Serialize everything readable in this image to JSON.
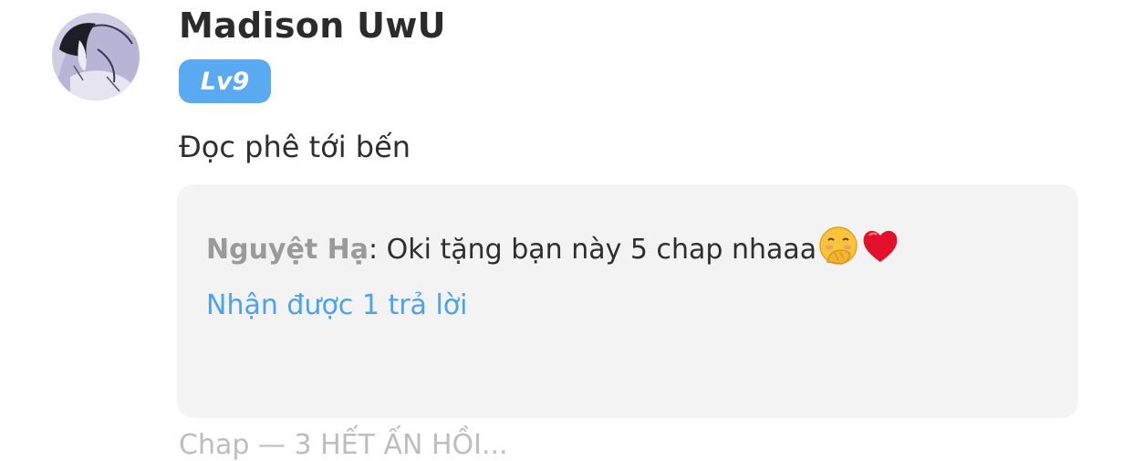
{
  "comment": {
    "username": "Madison UwU",
    "level": "Lv9",
    "text": "Đọc phê tới bến",
    "avatar_icon": "anime-character-avatar",
    "reply": {
      "author": "Nguyệt Hạ",
      "separator": ": ",
      "text": "Oki tặng bạn này 5 chap nhaaa",
      "emojis": [
        "face-with-hand-over-mouth-emoji",
        "red-heart-emoji"
      ],
      "reply_count_label": "Nhận được 1 trả lời"
    },
    "colors": {
      "level_badge": "#5aaaf2",
      "reply_link": "#4aa3ef",
      "reply_box_bg": "#f3f3f4",
      "author_gray": "#9a9a9a"
    }
  },
  "next_comment_peek": "Chap — 3 HẾT ẤN HỒI..."
}
